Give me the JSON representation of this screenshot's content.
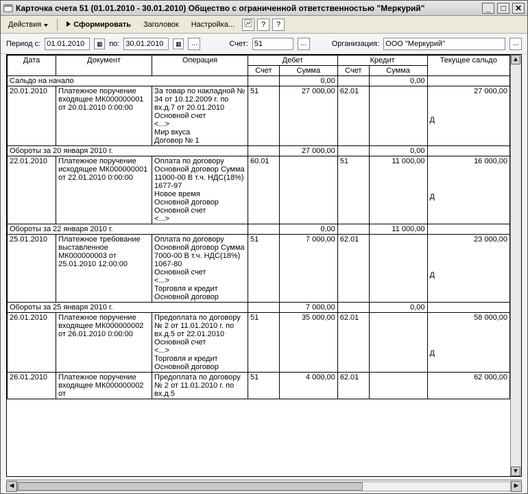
{
  "window": {
    "title": "Карточка счета 51 (01.01.2010 - 30.01.2010) Общество с ограниченной ответственностью \"Меркурий\""
  },
  "toolbar": {
    "actions": "Действия",
    "generate": "Сформировать",
    "header": "Заголовок",
    "settings": "Настройка...",
    "help": "?"
  },
  "filter": {
    "period_label": "Период с:",
    "period_from": "01.01.2010",
    "to_label": "по:",
    "period_to": "30.01.2010",
    "ellipsis": "...",
    "account_label": "Счет:",
    "account": "51",
    "org_label": "Организация:",
    "org": "ООО \"Меркурий\""
  },
  "headers": {
    "date": "Дата",
    "document": "Документ",
    "operation": "Операция",
    "debit": "Дебет",
    "credit": "Кредит",
    "balance": "Текущее сальдо",
    "account": "Счет",
    "sum": "Сумма"
  },
  "labels": {
    "opening": "Сальдо на начало",
    "turnover20": "Обороты за 20 января 2010 г.",
    "turnover22": "Обороты за 22 января 2010 г.",
    "turnover25": "Обороты за 25 января 2010 г.",
    "dc_d": "Д"
  },
  "rows": {
    "opening": {
      "debit_sum": "0,00",
      "credit_sum": "0,00"
    },
    "r1": {
      "date": "20.01.2010",
      "doc": "Платежное поручение входящее МК000000001 от 20.01.2010 0:00:00",
      "op": "За товар по накладной № 34 от 10.12.2009 г. по вх.д.7 от 20.01.2010\nОсновной счет\n<...>\nМир вкуса\nДоговор № 1",
      "dacc": "51",
      "dsum": "27 000,00",
      "cacc": "62.01",
      "csum": "",
      "bal": "27 000,00",
      "dc": "Д"
    },
    "t20": {
      "dsum": "27 000,00",
      "csum": "0,00"
    },
    "r2": {
      "date": "22.01.2010",
      "doc": "Платежное поручение исходящее МК000000001 от 22.01.2010 0:00:00",
      "op": "Оплата по договору Основной договор Сумма 11000-00 В т.ч. НДС(18%) 1677-97\nНовое время\nОсновной договор\nОсновной счет\n<...>",
      "dacc": "60.01",
      "dsum": "",
      "cacc": "51",
      "csum": "11 000,00",
      "bal": "16 000,00",
      "dc": "Д"
    },
    "t22": {
      "dsum": "0,00",
      "csum": "11 000,00"
    },
    "r3": {
      "date": "25.01.2010",
      "doc": "Платежное требование выставленное МК000000003 от 25.01.2010 12:00:00",
      "op": "Оплата по договору Основной договор Сумма 7000-00 В т.ч. НДС(18%) 1067-80\nОсновной счет\n<...>\nТорговля и кредит\nОсновной договор",
      "dacc": "51",
      "dsum": "7 000,00",
      "cacc": "62.01",
      "csum": "",
      "bal": "23 000,00",
      "dc": "Д"
    },
    "t25": {
      "dsum": "7 000,00",
      "csum": "0,00"
    },
    "r4": {
      "date": "26.01.2010",
      "doc": "Платежное поручение входящее МК000000002 от 26.01.2010 0:00:00",
      "op": "Предоплата по договору № 2 от 11.01.2010 г. по вх.д.5 от 22.01.2010\nОсновной счет\n<...>\nТорговля и кредит\nОсновной договор",
      "dacc": "51",
      "dsum": "35 000,00",
      "cacc": "62.01",
      "csum": "",
      "bal": "58 000,00",
      "dc": "Д"
    },
    "r5": {
      "date": "26.01.2010",
      "doc": "Платежное поручение входящее МК000000002 от",
      "op": "Предоплата по договору № 2 от 11.01.2010 г. по вх.д.5",
      "dacc": "51",
      "dsum": "4 000,00",
      "cacc": "62.01",
      "csum": "",
      "bal": "62 000,00",
      "dc": ""
    }
  }
}
